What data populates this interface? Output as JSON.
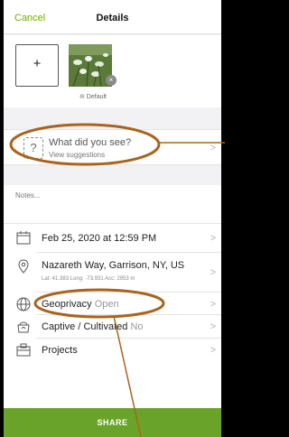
{
  "header": {
    "cancel_label": "Cancel",
    "title": "Details"
  },
  "photos": {
    "add_label": "+",
    "remove_label": "×",
    "default_label": "⊖ Default"
  },
  "species": {
    "prompt": "What did you see?",
    "sub": "View suggestions",
    "icon_label": "?"
  },
  "notes": {
    "placeholder": "Notes..."
  },
  "rows": {
    "date": {
      "label": "Feb 25, 2020 at 12:59 PM",
      "icon": "calendar-icon"
    },
    "location": {
      "label": "Nazareth Way, Garrison, NY, US",
      "coords": "Lat: 41.383  Long: -73.931  Acc: 2953 m",
      "icon": "location-pin-icon"
    },
    "geoprivacy": {
      "label": "Geoprivacy",
      "value": "Open",
      "icon": "globe-icon"
    },
    "captive": {
      "label": "Captive / Cultivated",
      "value": "No",
      "icon": "captive-icon"
    },
    "projects": {
      "label": "Projects",
      "icon": "projects-icon"
    }
  },
  "share": {
    "label": "SHARE"
  },
  "colors": {
    "accent": "#74ac00",
    "share_bg": "#6aa329",
    "annotation": "#a8641e"
  }
}
